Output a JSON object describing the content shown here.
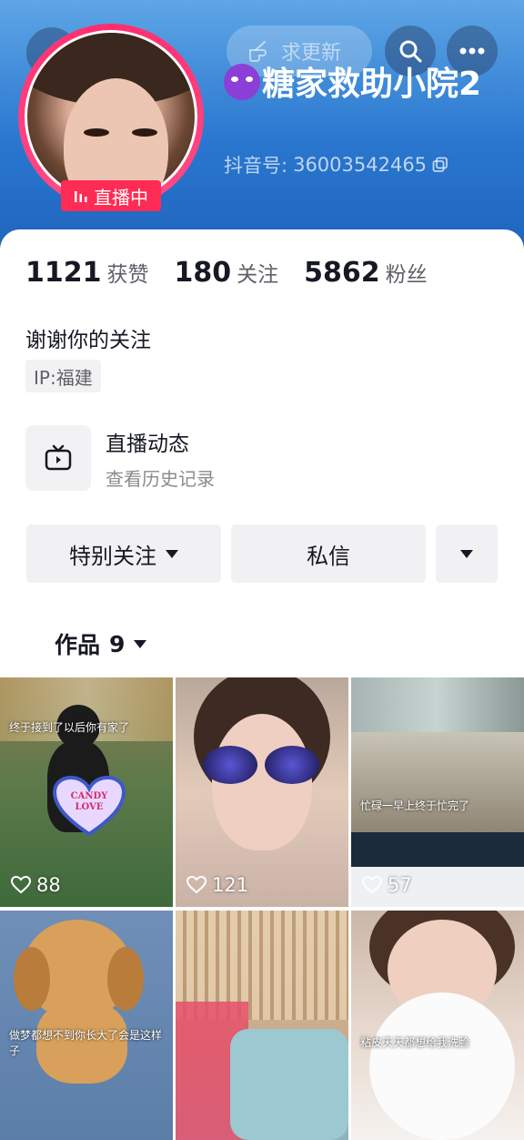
{
  "nav": {
    "request_update_label": "求更新"
  },
  "profile": {
    "name": "糖家救助小院2",
    "douyin_id_label": "抖音号:",
    "douyin_id": "36003542465",
    "live_badge": "直播中"
  },
  "stats": [
    {
      "value": "1121",
      "label": "获赞"
    },
    {
      "value": "180",
      "label": "关注"
    },
    {
      "value": "5862",
      "label": "粉丝"
    }
  ],
  "bio": "谢谢你的关注",
  "ip": "IP:福建",
  "live_feed": {
    "title": "直播动态",
    "subtitle": "查看历史记录"
  },
  "actions": {
    "special_follow": "特别关注",
    "message": "私信"
  },
  "works_tab": {
    "label": "作品",
    "count": "9"
  },
  "videos": [
    {
      "caption": "终于接到了以后你有家了",
      "likes": "88",
      "sticker": "CANDY LOVE"
    },
    {
      "caption": "",
      "likes": "121"
    },
    {
      "caption": "忙碌一早上终于忙完了",
      "likes": "57"
    },
    {
      "caption": "做梦都想不到你长大了会是这样子",
      "likes": ""
    },
    {
      "caption": "",
      "likes": ""
    },
    {
      "caption": "粘皮天天都想给我洗脸",
      "likes": ""
    }
  ],
  "colors": {
    "header_gradient_top": "#5ea6e6",
    "header_gradient_bottom": "#1f64bd",
    "live_red": "#fe2c55"
  }
}
